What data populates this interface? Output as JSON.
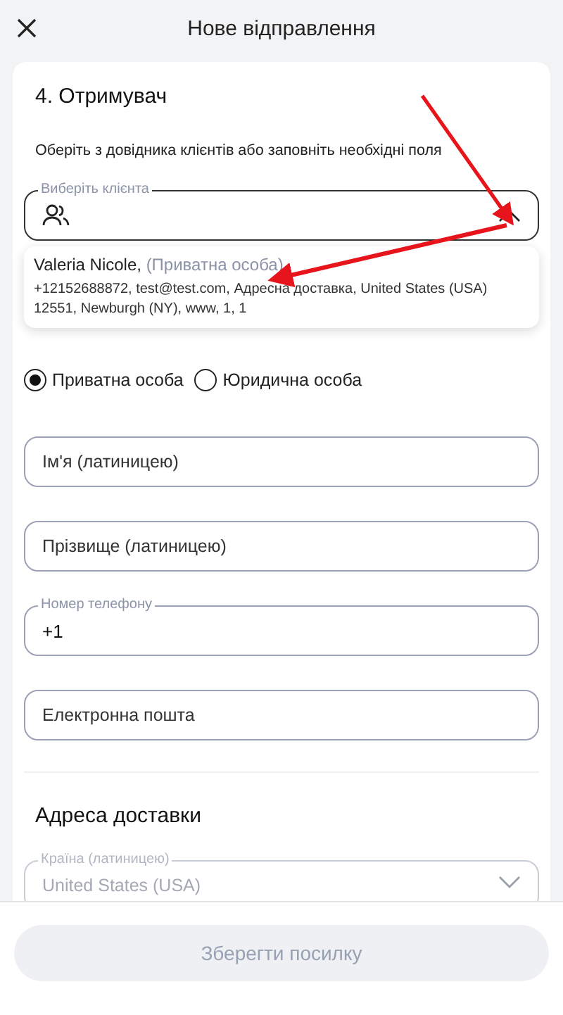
{
  "header": {
    "title": "Нове відправлення"
  },
  "section": {
    "title": "4. Отримувач",
    "hint": "Оберіть з довідника клієнтів або заповніть необхідні поля"
  },
  "client_select": {
    "label": "Виберіть клієнта",
    "expanded": true
  },
  "client_options": [
    {
      "name": "Valeria Nicole,",
      "type": "(Приватна особа)",
      "details": "+12152688872, test@test.com, Адресна доставка, United States (USA) 12551, Newburgh (NY), www, 1, 1"
    }
  ],
  "person_type": [
    {
      "label": "Приватна особа",
      "selected": true
    },
    {
      "label": "Юридична особа",
      "selected": false
    }
  ],
  "fields": [
    {
      "placeholder": "Ім'я (латиницею)"
    },
    {
      "placeholder": "Прізвище (латиницею)"
    },
    {
      "label": "Номер телефону",
      "value": "+1"
    },
    {
      "placeholder": "Електронна пошта"
    }
  ],
  "delivery": {
    "title": "Адреса доставки",
    "country": {
      "label": "Країна (латиницею)",
      "value": "United States (USA)",
      "disabled": true
    }
  },
  "footer": {
    "button": {
      "label": "Зберегти посилку",
      "disabled": true
    }
  }
}
